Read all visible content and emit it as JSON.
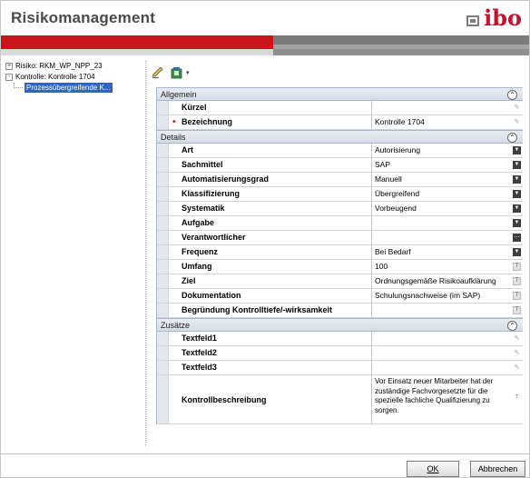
{
  "app": {
    "title": "Risikomanagement",
    "logo_text": "ibo",
    "brand_color": "#c8102e"
  },
  "tree": {
    "items": [
      {
        "expander": "+",
        "label": "Risiko: RKM_WP_NPP_23"
      },
      {
        "expander": "-",
        "label": "Kontrolle: Kontrolle 1704"
      },
      {
        "label": "Prozessübergreifende K..."
      }
    ]
  },
  "toolbar": {
    "dropdown_glyph": "▾"
  },
  "sections": {
    "allgemein": {
      "title": "Allgemein",
      "collapse_glyph": "⌃"
    },
    "details": {
      "title": "Details",
      "collapse_glyph": "⌃"
    },
    "zusaetze": {
      "title": "Zusätze",
      "collapse_glyph": "⌃"
    }
  },
  "fields": {
    "kuerzel": {
      "label": "Kürzel",
      "value": ""
    },
    "bezeichnung": {
      "label": "Bezeichnung",
      "value": "Kontrolle 1704",
      "required_mark": "•"
    },
    "art": {
      "label": "Art",
      "value": "Autorisierung"
    },
    "sachmittel": {
      "label": "Sachmittel",
      "value": "SAP"
    },
    "automatisierungsgrad": {
      "label": "Automatisierungsgrad",
      "value": "Manuell"
    },
    "klassifizierung": {
      "label": "Klassifizierung",
      "value": "Übergreifend"
    },
    "systematik": {
      "label": "Systematik",
      "value": "Vorbeugend"
    },
    "aufgabe": {
      "label": "Aufgabe",
      "value": ""
    },
    "verantwortlicher": {
      "label": "Verantwortlicher",
      "value": ""
    },
    "frequenz": {
      "label": "Frequenz",
      "value": "Bei Bedarf"
    },
    "umfang": {
      "label": "Umfang",
      "value": "100"
    },
    "ziel": {
      "label": "Ziel",
      "value": "Ordnungsgemäße Risikoaufklärung"
    },
    "dokumentation": {
      "label": "Dokumentation",
      "value": "Schulungsnachweise (im SAP)"
    },
    "begruendung": {
      "label": "Begründung Kontrolltiefe/-wirksamkeit",
      "value": ""
    },
    "textfeld1": {
      "label": "Textfeld1",
      "value": ""
    },
    "textfeld2": {
      "label": "Textfeld2",
      "value": ""
    },
    "textfeld3": {
      "label": "Textfeld3",
      "value": ""
    },
    "kontrollbeschreibung": {
      "label": "Kontrollbeschreibung",
      "value": "Vor Einsatz neuer Mitarbeiter hat der zuständige Fachvorgesetzte für die spezielle fachliche Qualifizierung zu sorgen."
    }
  },
  "controls": {
    "dropdown": "▼",
    "dots": "...",
    "text": "T",
    "mini": "✎"
  },
  "buttons": {
    "ok": "OK",
    "cancel": "Abbrechen"
  }
}
